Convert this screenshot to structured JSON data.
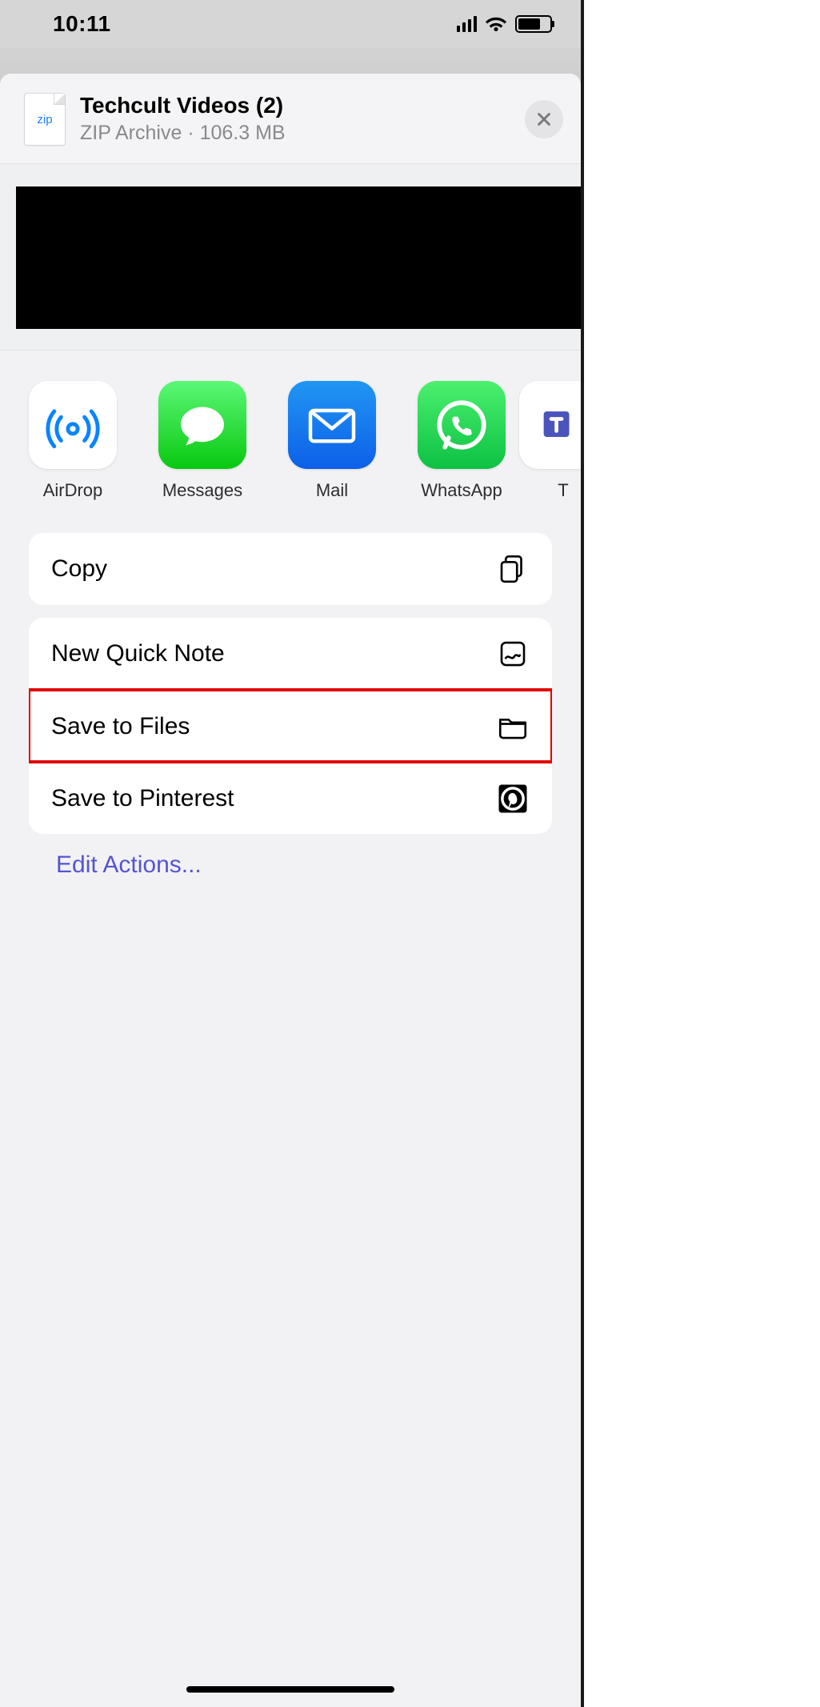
{
  "status": {
    "time": "10:11"
  },
  "file": {
    "badge": "zip",
    "name": "Techcult Videos (2)",
    "type": "ZIP Archive",
    "size": "106.3 MB"
  },
  "apps": [
    {
      "id": "airdrop",
      "label": "AirDrop"
    },
    {
      "id": "messages",
      "label": "Messages"
    },
    {
      "id": "mail",
      "label": "Mail"
    },
    {
      "id": "whatsapp",
      "label": "WhatsApp"
    },
    {
      "id": "teams",
      "label": "T"
    }
  ],
  "actions": {
    "copy": "Copy",
    "quicknote": "New Quick Note",
    "savefiles": "Save to Files",
    "pinterest": "Save to Pinterest",
    "edit": "Edit Actions..."
  }
}
